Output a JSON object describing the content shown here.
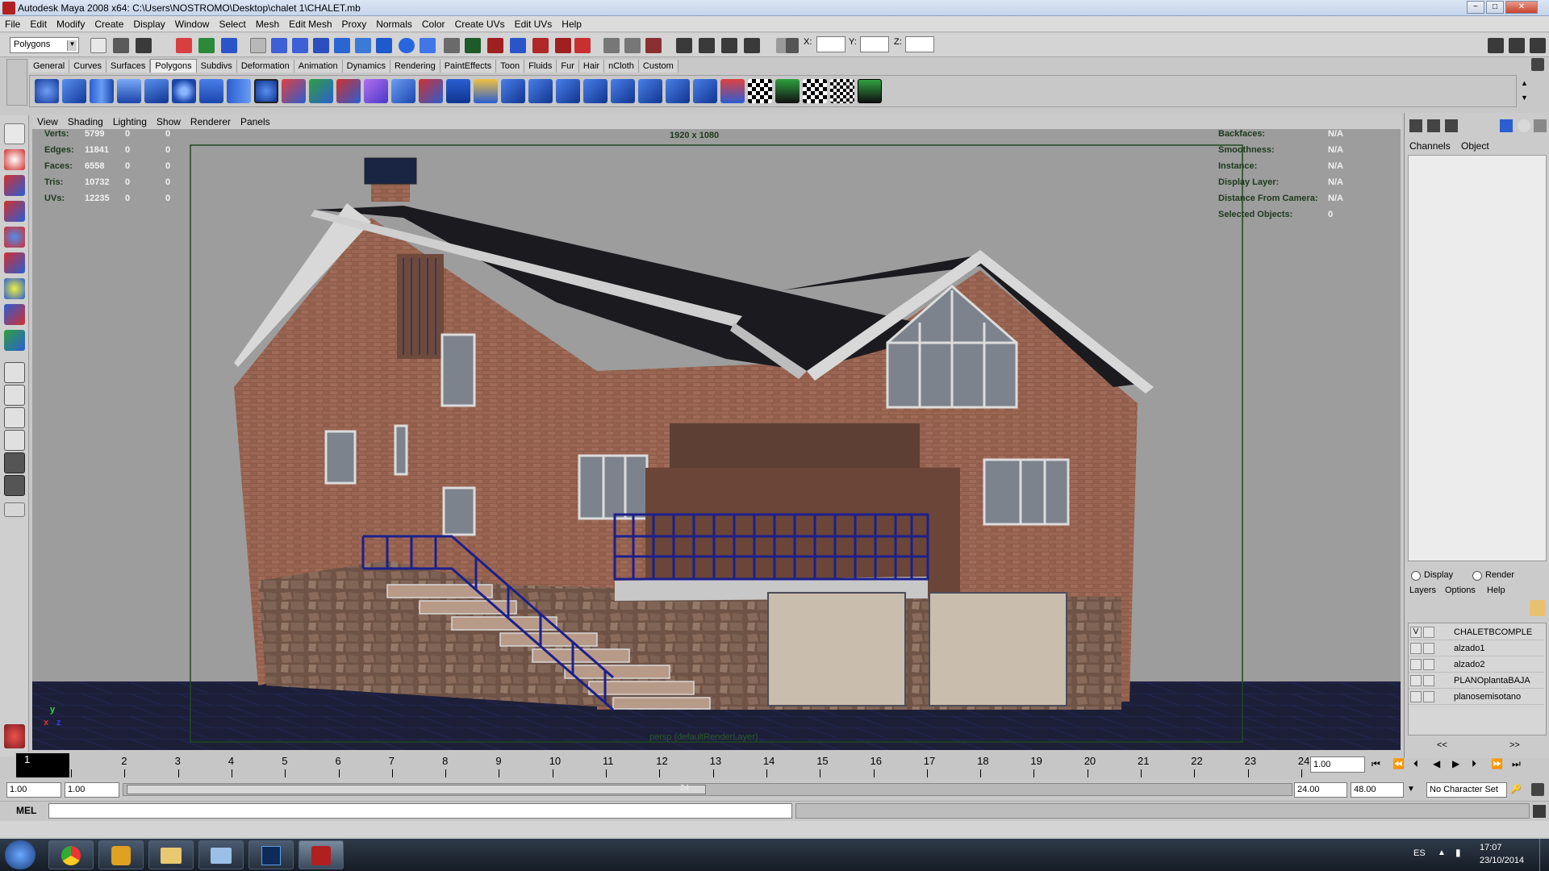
{
  "window": {
    "title": "Autodesk Maya 2008 x64: C:\\Users\\NOSTROMO\\Desktop\\chalet 1\\CHALET.mb",
    "min": "−",
    "max": "□",
    "close": "✕"
  },
  "menu": [
    "File",
    "Edit",
    "Modify",
    "Create",
    "Display",
    "Window",
    "Select",
    "Mesh",
    "Edit Mesh",
    "Proxy",
    "Normals",
    "Color",
    "Create UVs",
    "Edit UVs",
    "Help"
  ],
  "status": {
    "mode": "Polygons",
    "x_label": "X:",
    "y_label": "Y:",
    "z_label": "Z:"
  },
  "shelf_tabs": [
    "General",
    "Curves",
    "Surfaces",
    "Polygons",
    "Subdivs",
    "Deformation",
    "Animation",
    "Dynamics",
    "Rendering",
    "PaintEffects",
    "Toon",
    "Fluids",
    "Fur",
    "Hair",
    "nCloth",
    "Custom"
  ],
  "panel_menu": [
    "View",
    "Shading",
    "Lighting",
    "Show",
    "Renderer",
    "Panels"
  ],
  "hud_left": [
    {
      "label": "Verts:",
      "v1": "5799",
      "v2": "0",
      "v3": "0"
    },
    {
      "label": "Edges:",
      "v1": "11841",
      "v2": "0",
      "v3": "0"
    },
    {
      "label": "Faces:",
      "v1": "6558",
      "v2": "0",
      "v3": "0"
    },
    {
      "label": "Tris:",
      "v1": "10732",
      "v2": "0",
      "v3": "0"
    },
    {
      "label": "UVs:",
      "v1": "12235",
      "v2": "0",
      "v3": "0"
    }
  ],
  "hud_right": [
    {
      "label": "Backfaces:",
      "value": "N/A"
    },
    {
      "label": "Smoothness:",
      "value": "N/A"
    },
    {
      "label": "Instance:",
      "value": "N/A"
    },
    {
      "label": "Display Layer:",
      "value": "N/A"
    },
    {
      "label": "Distance From Camera:",
      "value": "N/A"
    },
    {
      "label": "Selected Objects:",
      "value": "0"
    }
  ],
  "resolution_gate": "1920 x 1080",
  "camera_label": "persp (defaultRenderLayer)",
  "axis": {
    "x": "x",
    "y": "y",
    "z": "z"
  },
  "channel_box": {
    "tab1": "Channels",
    "tab2": "Object"
  },
  "layer_editor": {
    "display": "Display",
    "render": "Render",
    "menu": [
      "Layers",
      "Options",
      "Help"
    ],
    "layers": [
      {
        "vis": "V",
        "name": "CHALETBCOMPLE"
      },
      {
        "vis": "",
        "name": "alzado1"
      },
      {
        "vis": "",
        "name": "alzado2"
      },
      {
        "vis": "",
        "name": "PLANOplantaBAJA"
      },
      {
        "vis": "",
        "name": "planosemisotano"
      }
    ],
    "scroll_left": "<<",
    "scroll_right": ">>"
  },
  "timeline": {
    "current_frame": "1",
    "frames": [
      "1",
      "2",
      "3",
      "4",
      "5",
      "6",
      "7",
      "8",
      "9",
      "10",
      "11",
      "12",
      "13",
      "14",
      "15",
      "16",
      "17",
      "18",
      "19",
      "20",
      "21",
      "22",
      "23",
      "24"
    ],
    "current_time": "1.00"
  },
  "range": {
    "start": "1.00",
    "start2": "1.00",
    "handle_end": "24",
    "end": "24.00",
    "anim_end": "48.00",
    "character_set": "No Character Set"
  },
  "mel_label": "MEL",
  "taskbar": {
    "lang": "ES",
    "time": "17:07",
    "date": "23/10/2014"
  }
}
